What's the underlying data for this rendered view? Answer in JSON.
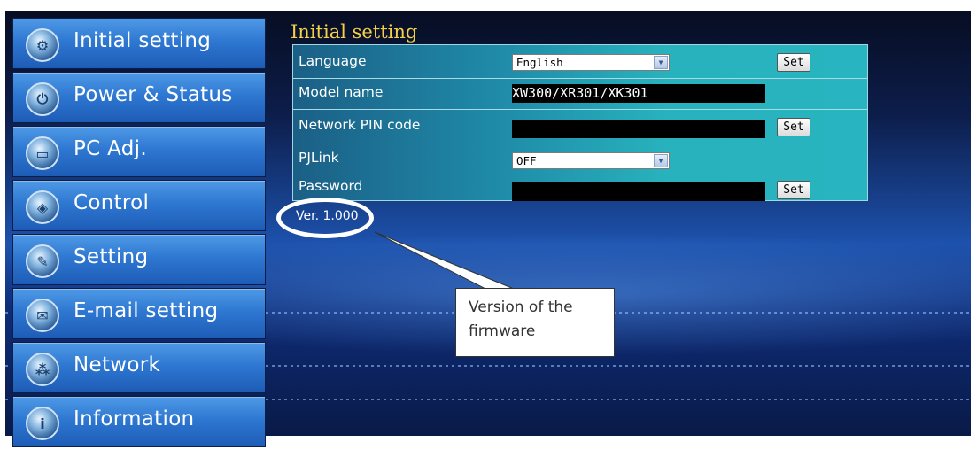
{
  "sidebar": {
    "items": [
      {
        "label": "Initial setting",
        "icon": "gear-icon"
      },
      {
        "label": "Power & Status",
        "icon": "power-icon"
      },
      {
        "label": "PC Adj.",
        "icon": "monitor-icon"
      },
      {
        "label": "Control",
        "icon": "control-icon"
      },
      {
        "label": "Setting",
        "icon": "wrench-icon"
      },
      {
        "label": "E-mail setting",
        "icon": "mail-icon"
      },
      {
        "label": "Network",
        "icon": "network-icon"
      },
      {
        "label": "Information",
        "icon": "info-icon"
      }
    ]
  },
  "panel": {
    "title": "Initial setting",
    "rows": {
      "language": {
        "label": "Language",
        "value": "English",
        "button": "Set"
      },
      "model": {
        "label": "Model name",
        "value": "XW300/XR301/XK301"
      },
      "pin": {
        "label": "Network PIN code",
        "value": "",
        "button": "Set"
      },
      "pjlink": {
        "label": "PJLink",
        "value": "OFF"
      },
      "password": {
        "label": "Password",
        "value": "",
        "button": "Set"
      }
    },
    "version": "Ver. 1.000"
  },
  "callout": {
    "text": "Version of the firmware"
  },
  "colors": {
    "title": "#f6d04a",
    "nav_bg": "#2e78d2",
    "table_bg": "#28b2bd",
    "background": "#0d1e4c"
  }
}
